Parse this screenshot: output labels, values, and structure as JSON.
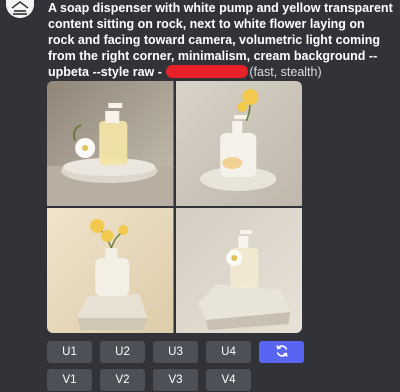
{
  "message": {
    "prompt_bold": "A soap dispenser with white pump and yellow transparent content sitting on rock, next to white flower laying on rock and facing toward camera, volumetric light coming from the right corner, minimalism, cream background --upbeta --style raw - ",
    "suffix": "(fast, stealth)"
  },
  "images": [
    {
      "alt": "soap dispenser with yellow liquid next to white flower on stone"
    },
    {
      "alt": "white dispenser with yellow flower on stone"
    },
    {
      "alt": "white bottle with yellow flowers on stone slab"
    },
    {
      "alt": "clear dispenser with white flower on stone block"
    }
  ],
  "buttons": {
    "upscale": [
      "U1",
      "U2",
      "U3",
      "U4"
    ],
    "variation": [
      "V1",
      "V2",
      "V3",
      "V4"
    ],
    "reroll_icon": "refresh-icon"
  },
  "colors": {
    "primary": "#5865f2",
    "secondary": "#4e5058",
    "redaction": "#e8202a"
  }
}
